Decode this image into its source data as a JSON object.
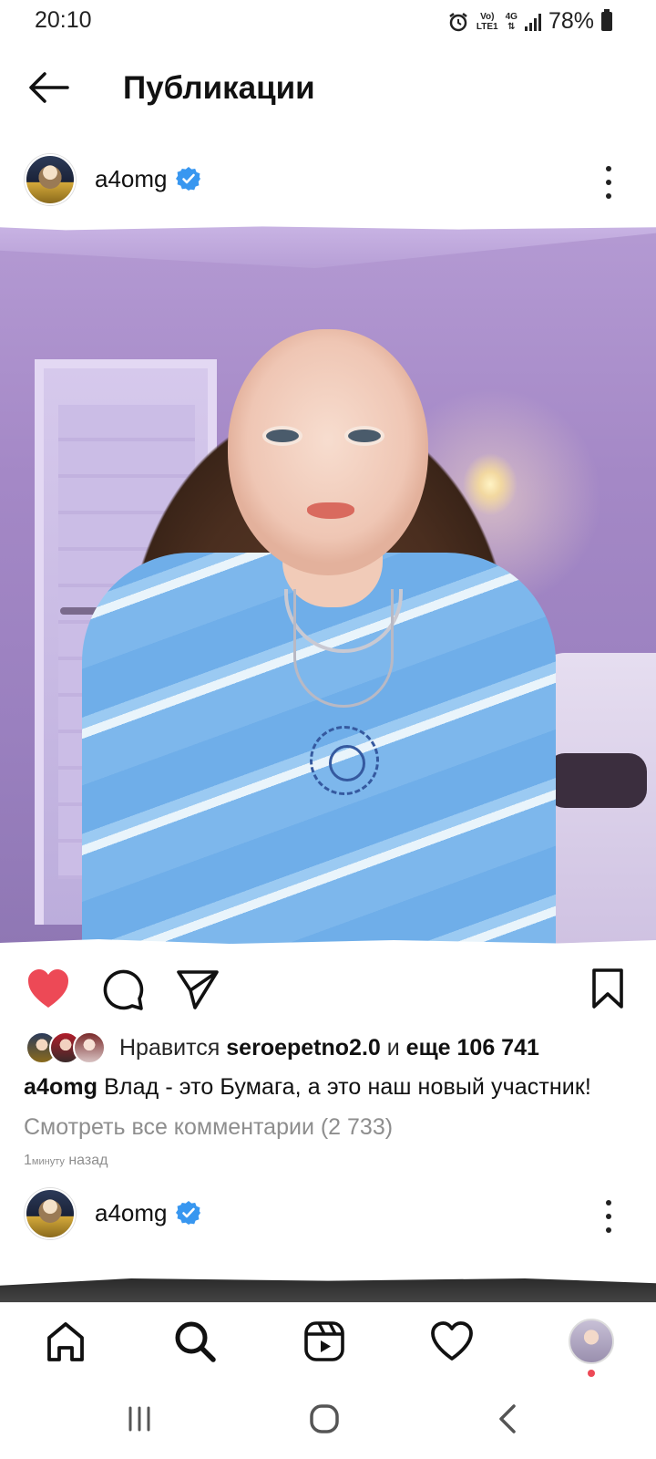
{
  "status_bar": {
    "time": "20:10",
    "net_top": "Vo)",
    "net_bottom": "LTE1",
    "net_type": "4G",
    "battery": "78%"
  },
  "header": {
    "title": "Публикации"
  },
  "post": {
    "username": "a4omg",
    "verified_color": "#3897f0",
    "likes_prefix": "Нравится",
    "liked_by": "seroepetno2.0",
    "likes_conj": "и",
    "likes_more": "еще 106 741",
    "caption_user": "a4omg",
    "caption_text": "Влад - это Бумага, а это наш новый участник!",
    "view_comments": "Смотреть все комментарии (2 733)",
    "time_num": "1",
    "time_unit": "минуту",
    "time_suffix": "назад",
    "like_color": "#ed4956"
  },
  "next_post": {
    "username": "a4omg"
  },
  "bottom_nav": {
    "items": [
      "home-icon",
      "search-icon",
      "reels-icon",
      "heart-icon",
      "profile-avatar"
    ],
    "dot_color": "#ed4956"
  },
  "system_nav": {
    "items": [
      "recents-icon",
      "home-button-icon",
      "back-icon"
    ]
  }
}
